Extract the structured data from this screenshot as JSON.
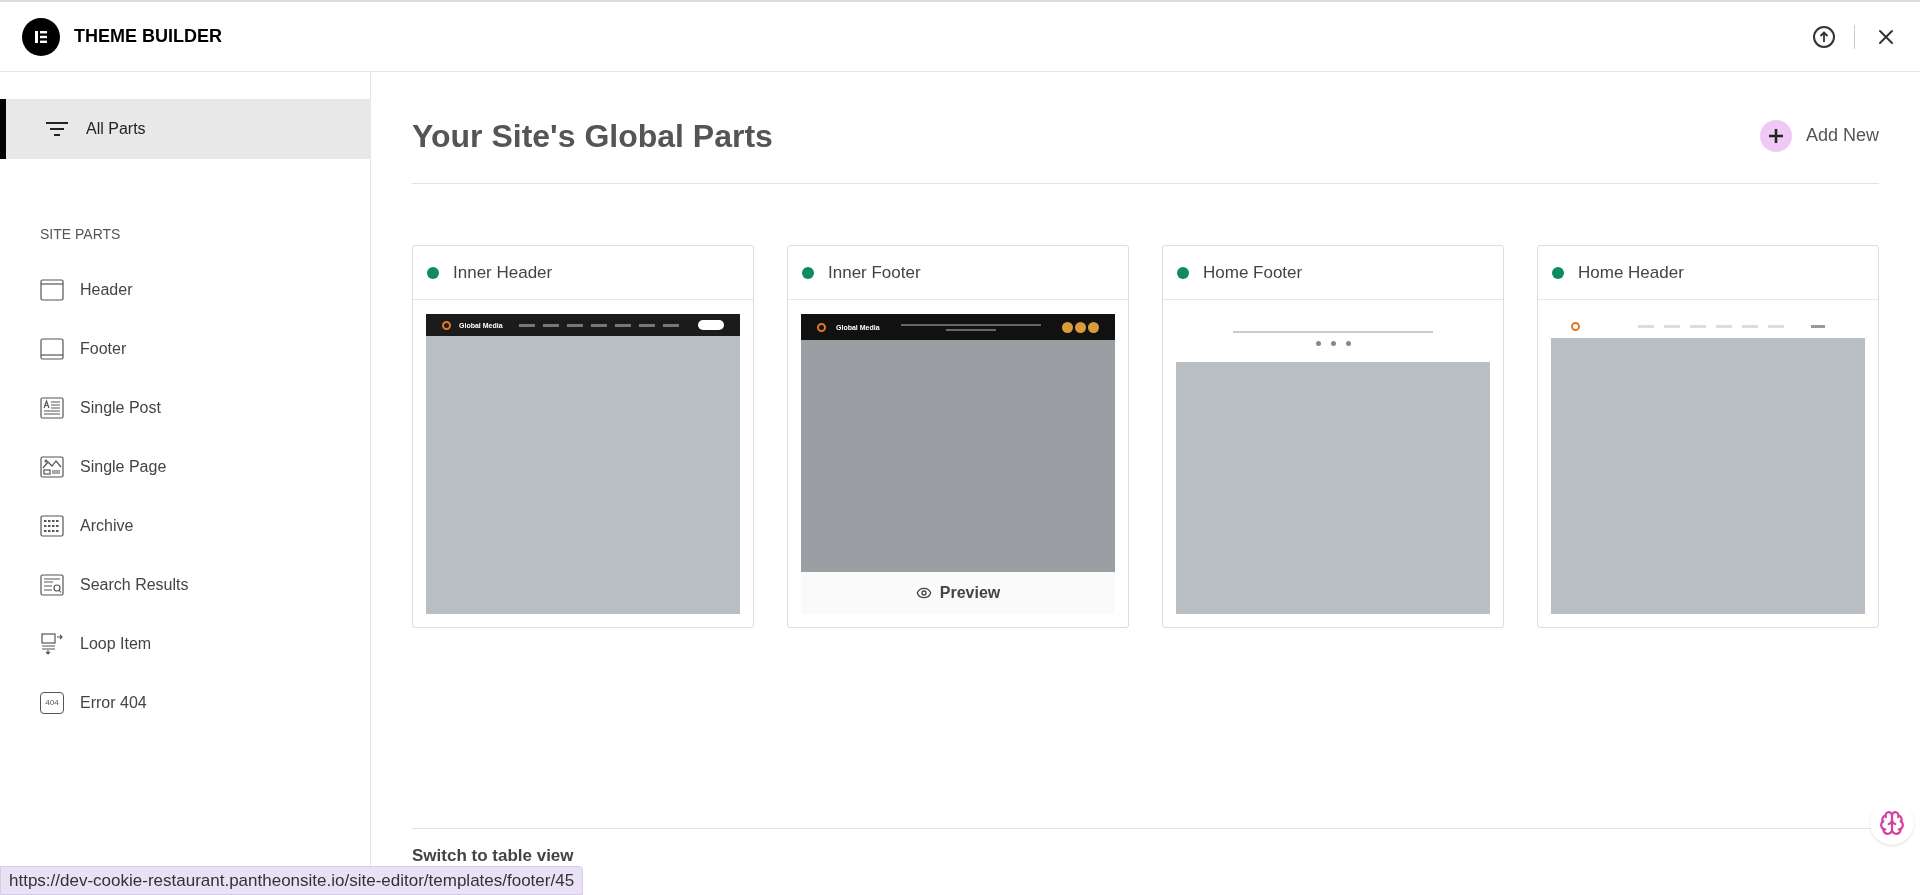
{
  "topbar": {
    "title": "THEME BUILDER"
  },
  "sidebar": {
    "items": [
      {
        "label": "All Parts",
        "selected": true
      }
    ],
    "section_title": "SITE PARTS",
    "parts": [
      {
        "label": "Header",
        "kind": "header"
      },
      {
        "label": "Footer",
        "kind": "footer"
      },
      {
        "label": "Single Post",
        "kind": "post"
      },
      {
        "label": "Single Page",
        "kind": "page"
      },
      {
        "label": "Archive",
        "kind": "archive"
      },
      {
        "label": "Search Results",
        "kind": "search"
      },
      {
        "label": "Loop Item",
        "kind": "loop"
      },
      {
        "label": "Error 404",
        "kind": "error",
        "icon_text": "404"
      }
    ]
  },
  "main": {
    "title": "Your Site's Global Parts",
    "add_button": "Add New",
    "cards": [
      {
        "title": "Inner Header",
        "color": "#0f8a62",
        "hovered": false,
        "thumbnail": {
          "kind": "dark-header",
          "brand": "Global Media"
        }
      },
      {
        "title": "Inner Footer",
        "color": "#0f8a62",
        "hovered": true,
        "preview": "Preview",
        "thumbnail": {
          "kind": "dark-footer",
          "brand": "Global Media"
        }
      },
      {
        "title": "Home Footer",
        "color": "#0f8a62",
        "hovered": false,
        "thumbnail": {
          "kind": "light-footer"
        }
      },
      {
        "title": "Home Header",
        "color": "#0f8a62",
        "hovered": false,
        "thumbnail": {
          "kind": "light-header"
        }
      }
    ],
    "switch_link": "Switch to table view"
  },
  "status_bar": {
    "url": "https://dev-cookie-restaurant.pantheonsite.io/site-editor/templates/footer/45"
  }
}
